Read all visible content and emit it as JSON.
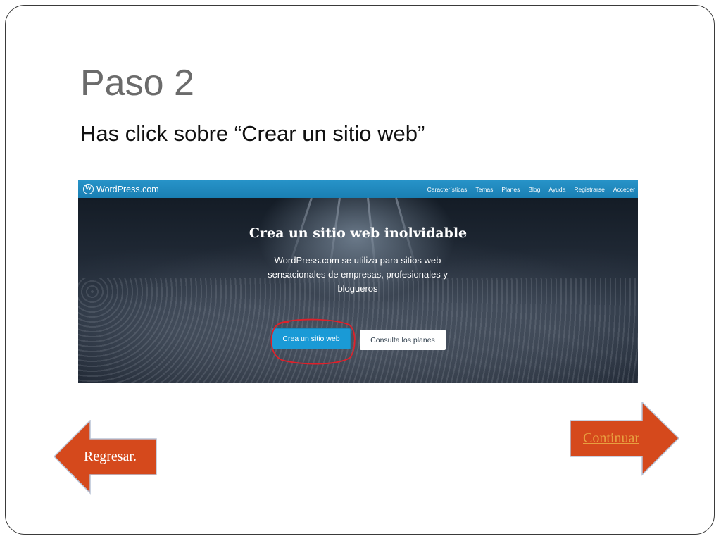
{
  "slide": {
    "title": "Paso 2",
    "subtitle": "Has click sobre “Crear un sitio web”"
  },
  "screenshot": {
    "brand": "WordPress.com",
    "logo_icon": "wordpress-logo-icon",
    "menu": [
      "Características",
      "Temas",
      "Planes",
      "Blog",
      "Ayuda",
      "Registrarse",
      "Acceder"
    ],
    "hero_title": "Crea un sitio web inolvidable",
    "hero_description": "WordPress.com se utiliza para sitios web sensacionales de empresas, profesionales y blogueros",
    "primary_button": "Crea un sitio web",
    "secondary_button": "Consulta los planes",
    "highlight_color": "#e0202a",
    "nav_color": "#1e8cbe"
  },
  "navigation": {
    "back_label": "Regresar.",
    "next_label": "Continuar",
    "arrow_color": "#d5491c"
  }
}
